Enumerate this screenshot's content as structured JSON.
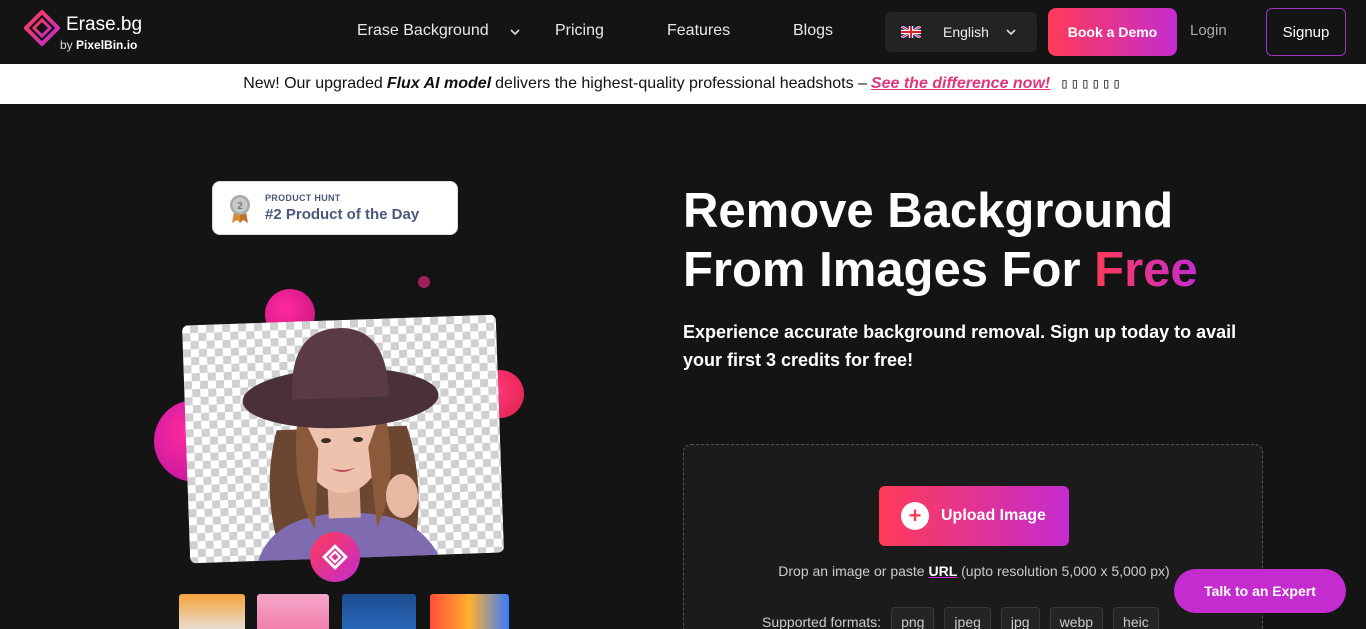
{
  "brand": {
    "title": "Erase.bg",
    "sub_prefix": "by",
    "sub_name": "PixelBin.io"
  },
  "nav": {
    "erase_background": "Erase Background",
    "pricing": "Pricing",
    "features": "Features",
    "blogs": "Blogs",
    "language": "English",
    "book_demo": "Book a Demo",
    "login": "Login",
    "signup": "Signup"
  },
  "banner": {
    "prefix": "New! Our upgraded",
    "emphasis": "Flux AI model",
    "middle": "delivers the highest-quality professional headshots –",
    "link": "See the difference now!",
    "tail": "▯▯▯▯▯▯"
  },
  "product_hunt": {
    "kicker": "PRODUCT HUNT",
    "title": "#2 Product of the Day",
    "rank": "2"
  },
  "hero": {
    "title_line1": "Remove Background",
    "title_line2_prefix": "From Images For ",
    "title_highlight": "Free",
    "subtitle": "Experience accurate background removal. Sign up today to avail your first 3 credits for free!"
  },
  "upload": {
    "button_label": "Upload Image",
    "drop_prefix": "Drop an image or paste ",
    "drop_url": "URL",
    "drop_suffix": " (upto resolution 5,000 x 5,000 px)",
    "formats_label": "Supported formats:",
    "formats": [
      "png",
      "jpeg",
      "jpg",
      "webp",
      "heic"
    ]
  },
  "chat": {
    "label": "Talk to an Expert"
  },
  "colors": {
    "accent_start": "#ff3b57",
    "accent_end": "#c42ccf",
    "bg": "#141414"
  }
}
